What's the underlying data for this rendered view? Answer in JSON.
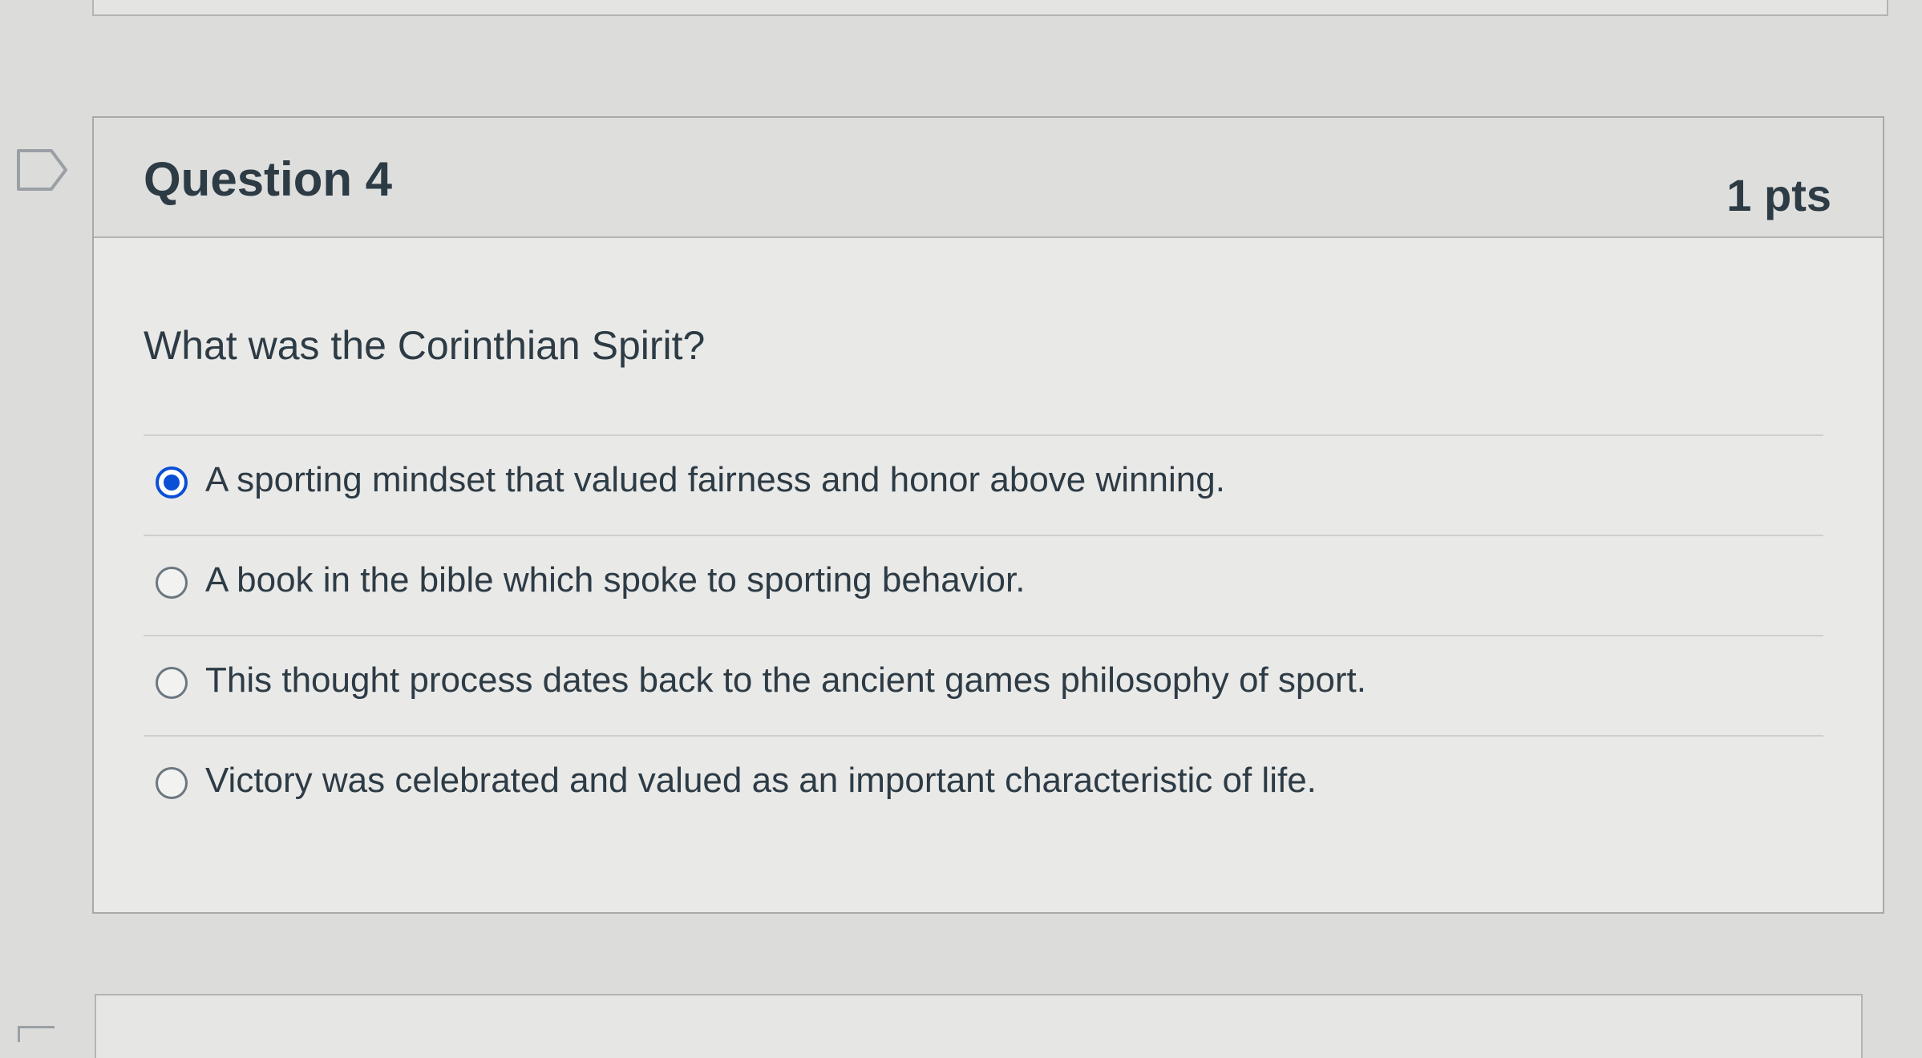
{
  "question": {
    "title": "Question 4",
    "points": "1 pts",
    "text": "What was the Corinthian Spirit?",
    "flag_icon": "flag-bookmark-icon",
    "answers": [
      {
        "label": "A sporting mindset that valued fairness and honor above winning.",
        "selected": true
      },
      {
        "label": "A book in the bible which spoke to sporting behavior.",
        "selected": false
      },
      {
        "label": "This thought process dates back to the ancient games philosophy of sport.",
        "selected": false
      },
      {
        "label": "Victory was celebrated and valued as an important characteristic of life.",
        "selected": false
      }
    ]
  },
  "colors": {
    "accent": "#0a4fd6",
    "text": "#2d3b45",
    "border": "#a9a9a7"
  }
}
